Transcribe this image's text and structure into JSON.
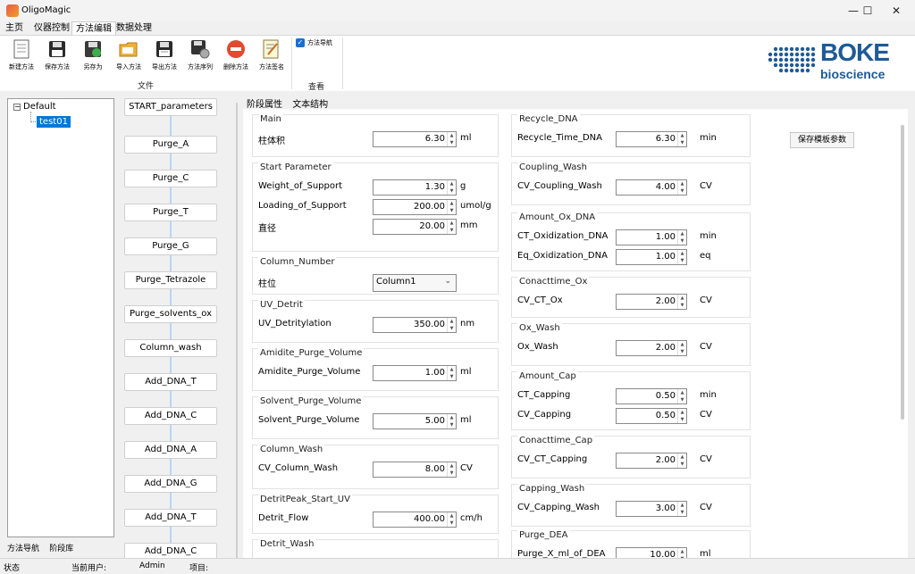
{
  "window": {
    "title": "OligoMagic",
    "minimize": "—",
    "maximize": "☐",
    "close": "✕"
  },
  "menu": {
    "items": [
      "主页",
      "仪器控制",
      "方法编辑",
      "数据处理"
    ]
  },
  "toolbar": {
    "buttons": [
      {
        "label": "新建方法",
        "icon": "new-document-icon"
      },
      {
        "label": "保存方法",
        "icon": "save-icon"
      },
      {
        "label": "另存为",
        "icon": "save-as-icon"
      },
      {
        "label": "导入方法",
        "icon": "import-folder-icon"
      },
      {
        "label": "导出方法",
        "icon": "export-icon"
      },
      {
        "label": "方法序列",
        "icon": "method-sequence-icon"
      },
      {
        "label": "删除方法",
        "icon": "delete-icon"
      },
      {
        "label": "方法签名",
        "icon": "signature-icon"
      }
    ],
    "group_file": "文件",
    "nav_checkbox": "方法导航",
    "group_view": "查看"
  },
  "logo": {
    "brand": "BOKE",
    "sub": "bioscience",
    "color": "#1e5a96"
  },
  "tree": {
    "root": "Default",
    "child": "test01"
  },
  "bottom_tabs": [
    "方法导航",
    "阶段库"
  ],
  "stages": [
    "START_parameters",
    "Purge_A",
    "Purge_C",
    "Purge_T",
    "Purge_G",
    "Purge_Tetrazole",
    "Purge_solvents_ox",
    "Column_wash",
    "Add_DNA_T",
    "Add_DNA_C",
    "Add_DNA_A",
    "Add_DNA_G",
    "Add_DNA_T",
    "Add_DNA_C"
  ],
  "panel_tabs": [
    "阶段属性",
    "文本结构"
  ],
  "left_groups": [
    {
      "title": "Main",
      "fields": [
        {
          "label": "柱体积",
          "value": "6.30",
          "unit": "ml"
        }
      ]
    },
    {
      "title": "Start Parameter",
      "fields": [
        {
          "label": "Weight_of_Support",
          "value": "1.30",
          "unit": "g"
        },
        {
          "label": "Loading_of_Support",
          "value": "200.00",
          "unit": "umol/g"
        },
        {
          "label": "直径",
          "value": "20.00",
          "unit": "mm"
        }
      ]
    },
    {
      "title": "Column_Number",
      "fields": [
        {
          "label": "柱位",
          "combo": "Column1"
        }
      ]
    },
    {
      "title": "UV_Detrit",
      "fields": [
        {
          "label": "UV_Detritylation",
          "value": "350.00",
          "unit": "nm"
        }
      ]
    },
    {
      "title": "Amidite_Purge_Volume",
      "fields": [
        {
          "label": "Amidite_Purge_Volume",
          "value": "1.00",
          "unit": "ml"
        }
      ]
    },
    {
      "title": "Solvent_Purge_Volume",
      "fields": [
        {
          "label": "Solvent_Purge_Volume",
          "value": "5.00",
          "unit": "ml"
        }
      ]
    },
    {
      "title": "Column_Wash",
      "fields": [
        {
          "label": "CV_Column_Wash",
          "value": "8.00",
          "unit": "CV"
        }
      ]
    },
    {
      "title": "DetritPeak_Start_UV",
      "fields": [
        {
          "label": "Detrit_Flow",
          "value": "400.00",
          "unit": "cm/h"
        }
      ]
    },
    {
      "title": "Detrit_Wash",
      "fields": []
    }
  ],
  "right_groups": [
    {
      "title": "Recycle_DNA",
      "fields": [
        {
          "label": "Recycle_Time_DNA",
          "value": "6.30",
          "unit": "min"
        }
      ]
    },
    {
      "title": "Coupling_Wash",
      "fields": [
        {
          "label": "CV_Coupling_Wash",
          "value": "4.00",
          "unit": "CV"
        }
      ]
    },
    {
      "title": "Amount_Ox_DNA",
      "fields": [
        {
          "label": "CT_Oxidization_DNA",
          "value": "1.00",
          "unit": "min"
        },
        {
          "label": "Eq_Oxidization_DNA",
          "value": "1.00",
          "unit": "eq"
        }
      ]
    },
    {
      "title": "Conacttime_Ox",
      "fields": [
        {
          "label": "CV_CT_Ox",
          "value": "2.00",
          "unit": "CV"
        }
      ]
    },
    {
      "title": "Ox_Wash",
      "fields": [
        {
          "label": "Ox_Wash",
          "value": "2.00",
          "unit": "CV"
        }
      ]
    },
    {
      "title": "Amount_Cap",
      "fields": [
        {
          "label": "CT_Capping",
          "value": "0.50",
          "unit": "min"
        },
        {
          "label": "CV_Capping",
          "value": "0.50",
          "unit": "CV"
        }
      ]
    },
    {
      "title": "Conacttime_Cap",
      "fields": [
        {
          "label": "CV_CT_Capping",
          "value": "2.00",
          "unit": "CV"
        }
      ]
    },
    {
      "title": "Capping_Wash",
      "fields": [
        {
          "label": "CV_Capping_Wash",
          "value": "3.00",
          "unit": "CV"
        }
      ]
    },
    {
      "title": "Purge_DEA",
      "fields": [
        {
          "label": "Purge_X_ml_of_DEA",
          "value": "10.00",
          "unit": "ml"
        }
      ]
    }
  ],
  "save_template_button": "保存模板参数",
  "status": {
    "label": "状态",
    "user_label": "当前用户:",
    "user": "Admin",
    "project_label": "项目:"
  }
}
